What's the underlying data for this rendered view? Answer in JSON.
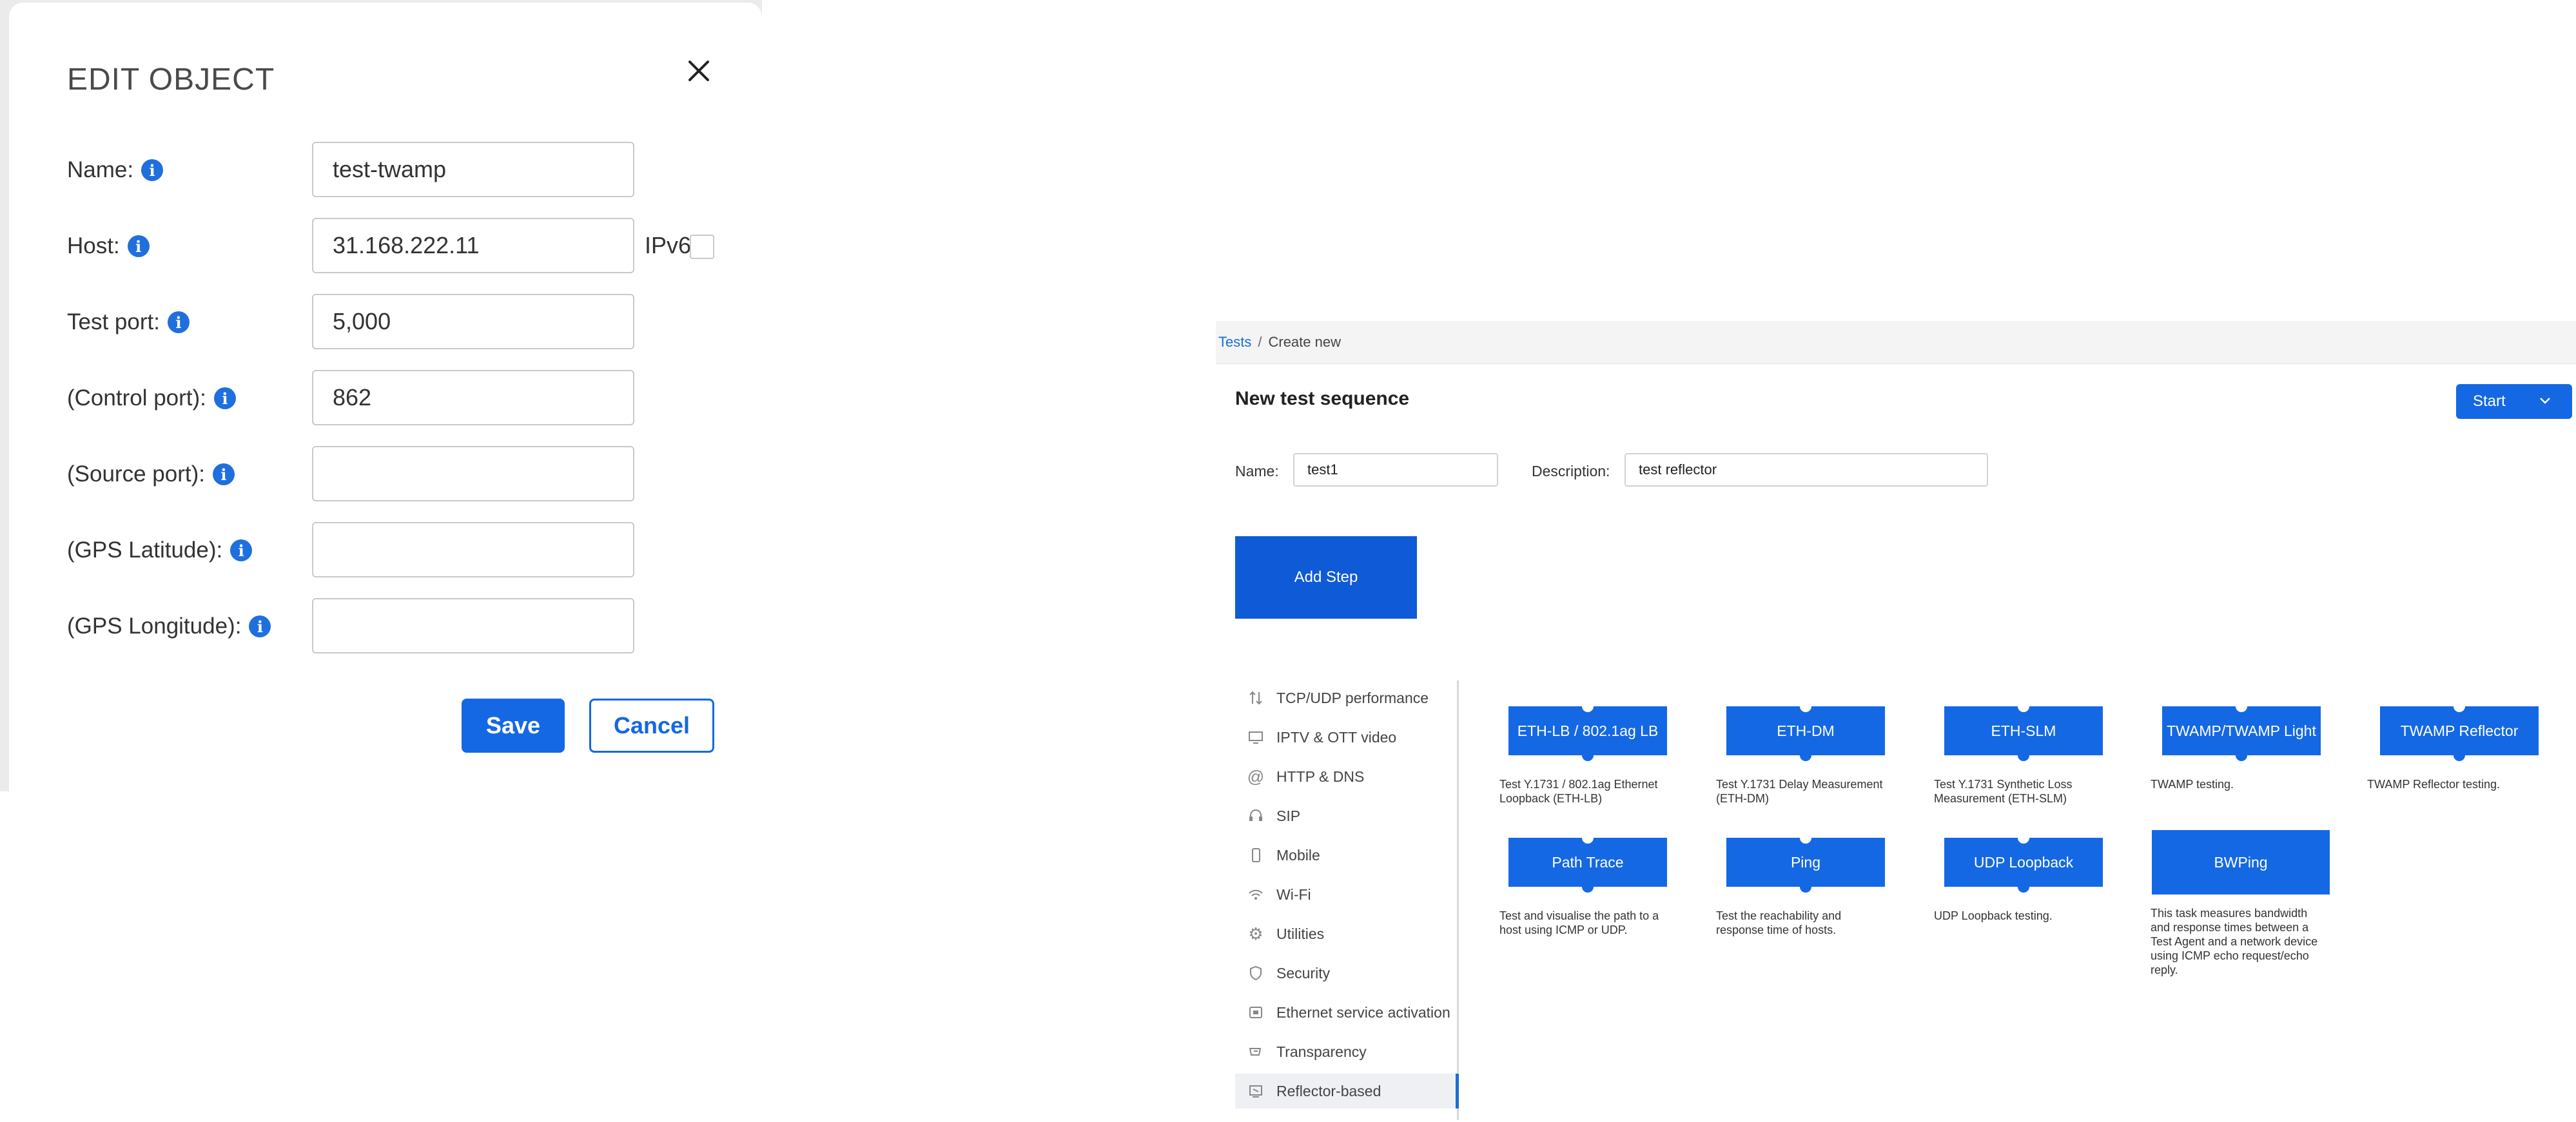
{
  "edit_modal": {
    "title": "EDIT OBJECT",
    "fields": [
      {
        "label": "Name:",
        "value": "test-twamp"
      },
      {
        "label": "Host:",
        "value": "31.168.222.11"
      },
      {
        "label": "Test port:",
        "value": "5,000"
      },
      {
        "label": "(Control port):",
        "value": "862"
      },
      {
        "label": "(Source port):",
        "value": ""
      },
      {
        "label": "(GPS Latitude):",
        "value": ""
      },
      {
        "label": "(GPS Longitude):",
        "value": ""
      }
    ],
    "ipv6_label": "IPv6",
    "ipv6_checked": false,
    "save_label": "Save",
    "cancel_label": "Cancel"
  },
  "test_page": {
    "breadcrumb": {
      "root": "Tests",
      "separator": "/",
      "current": "Create new"
    },
    "heading": "New test sequence",
    "start_label": "Start",
    "name_label": "Name:",
    "name_value": "test1",
    "description_label": "Description:",
    "description_value": "test reflector",
    "add_step_label": "Add Step",
    "categories": [
      {
        "label": "TCP/UDP performance",
        "icon": "arrows-icon"
      },
      {
        "label": "IPTV & OTT video",
        "icon": "monitor-icon"
      },
      {
        "label": "HTTP & DNS",
        "icon": "at-icon"
      },
      {
        "label": "SIP",
        "icon": "headset-icon"
      },
      {
        "label": "Mobile",
        "icon": "phone-icon"
      },
      {
        "label": "Wi-Fi",
        "icon": "wifi-icon"
      },
      {
        "label": "Utilities",
        "icon": "gear-icon"
      },
      {
        "label": "Security",
        "icon": "shield-icon"
      },
      {
        "label": "Ethernet service activation",
        "icon": "ethernet-icon"
      },
      {
        "label": "Transparency",
        "icon": "transparency-icon"
      },
      {
        "label": "Reflector-based",
        "icon": "reflector-icon",
        "active": true
      }
    ],
    "tiles": [
      {
        "label": "ETH-LB / 802.1ag LB",
        "desc": "Test Y.1731 / 802.1ag Ethernet Loopback (ETH-LB)"
      },
      {
        "label": "ETH-DM",
        "desc": "Test Y.1731 Delay Measurement (ETH-DM)"
      },
      {
        "label": "ETH-SLM",
        "desc": "Test Y.1731 Synthetic Loss Measurement (ETH-SLM)"
      },
      {
        "label": "TWAMP/TWAMP Light",
        "desc": "TWAMP testing."
      },
      {
        "label": "TWAMP Reflector",
        "desc": "TWAMP Reflector testing."
      },
      {
        "label": "Path Trace",
        "desc": "Test and visualise the path to a host using ICMP or UDP."
      },
      {
        "label": "Ping",
        "desc": "Test the reachability and response time of hosts."
      },
      {
        "label": "UDP Loopback",
        "desc": "UDP Loopback testing."
      },
      {
        "label": "BWPing",
        "desc": "This task measures bandwidth and response times between a Test Agent and a network device using ICMP echo request/echo reply."
      }
    ],
    "colors": {
      "accent": "#1468e4",
      "link": "#1a6fd0"
    }
  }
}
